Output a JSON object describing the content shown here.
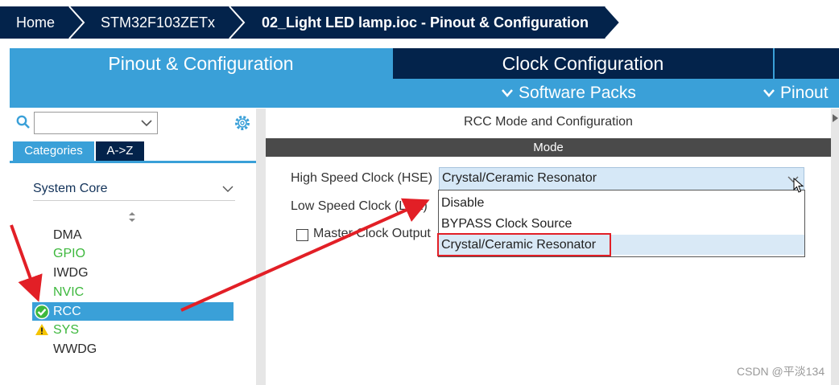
{
  "breadcrumb": {
    "items": [
      "Home",
      "STM32F103ZETx",
      "02_Light LED lamp.ioc - Pinout & Configuration"
    ]
  },
  "main_tabs": {
    "pinout": "Pinout & Configuration",
    "clock": "Clock Configuration"
  },
  "sub_toolbar": {
    "software_packs": "Software Packs",
    "pinout": "Pinout"
  },
  "left_panel": {
    "tabs": {
      "categories": "Categories",
      "a_to_z": "A->Z"
    },
    "category": "System Core",
    "peripherals": [
      {
        "name": "DMA",
        "color": "#2b2b2b",
        "status": ""
      },
      {
        "name": "GPIO",
        "color": "#3db83d",
        "status": ""
      },
      {
        "name": "IWDG",
        "color": "#2b2b2b",
        "status": ""
      },
      {
        "name": "NVIC",
        "color": "#3db83d",
        "status": ""
      },
      {
        "name": "RCC",
        "color": "#ffffff",
        "status": "configured",
        "selected": true
      },
      {
        "name": "SYS",
        "color": "#3db83d",
        "status": "warning"
      },
      {
        "name": "WWDG",
        "color": "#2b2b2b",
        "status": ""
      }
    ]
  },
  "right_panel": {
    "title": "RCC Mode and Configuration",
    "mode_header": "Mode",
    "hse_label": "High Speed Clock (HSE)",
    "hse_value": "Crystal/Ceramic Resonator",
    "lse_label": "Low Speed Clock (LSE)",
    "mco_label": "Master Clock Output",
    "dropdown_options": [
      "Disable",
      "BYPASS Clock Source",
      "Crystal/Ceramic Resonator"
    ]
  },
  "colors": {
    "navy": "#03234b",
    "accent_blue": "#3aa0d8",
    "annotation_red": "#e21f26"
  },
  "watermark": "CSDN @平淡134"
}
